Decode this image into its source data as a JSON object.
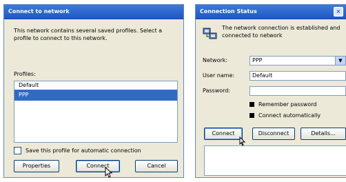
{
  "left_dialog": {
    "title": "Connect to network",
    "message": "This network contains several saved profiles. Select a profile to connect to this network.",
    "list_label": "Profiles:",
    "items": [
      "Default",
      "PPP"
    ],
    "selected_index": 1,
    "checkbox_label": "Save this profile for automatic connection",
    "checkbox_checked": false,
    "buttons": {
      "properties": "Properties",
      "connect": "Connect",
      "cancel": "Cancel"
    }
  },
  "right_dialog": {
    "title": "Connection Status",
    "close_glyph": "×",
    "message": "The network connection is established and connected to network",
    "fields": {
      "network_label": "Network:",
      "network_value": "PPP",
      "username_label": "User name:",
      "username_value": "Default",
      "password_label": "Password:",
      "password_value": ""
    },
    "options": {
      "remember_label": "Remember password",
      "remember_checked": true,
      "auto_label": "Connect automatically",
      "auto_checked": false
    },
    "buttons": {
      "connect": "Connect",
      "disconnect": "Disconnect",
      "more": "Details..."
    }
  }
}
